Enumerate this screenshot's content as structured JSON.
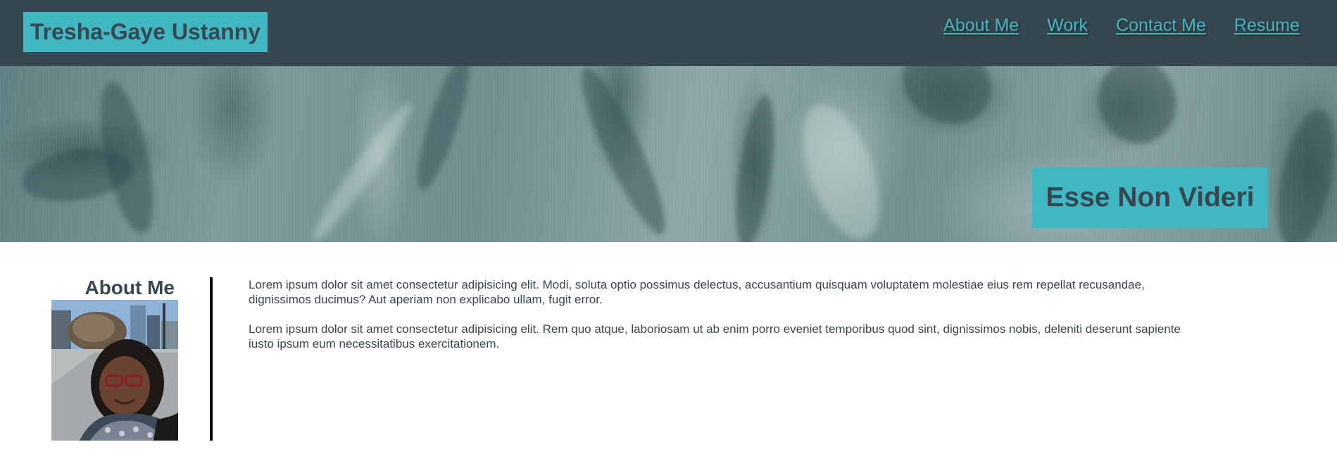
{
  "header": {
    "brand_name": "Tresha-Gaye Ustanny",
    "nav": [
      {
        "label": "About Me"
      },
      {
        "label": "Work"
      },
      {
        "label": "Contact Me"
      },
      {
        "label": "Resume"
      }
    ]
  },
  "hero": {
    "tagline": "Esse Non Videri"
  },
  "about": {
    "heading": "About Me",
    "paragraphs": [
      "Lorem ipsum dolor sit amet consectetur adipisicing elit. Modi, soluta optio possimus delectus, accusantium quisquam voluptatem molestiae eius rem repellat recusandae, dignissimos ducimus? Aut aperiam non explicabo ullam, fugit error.",
      "Lorem ipsum dolor sit amet consectetur adipisicing elit. Rem quo atque, laboriosam ut ab enim porro eveniet temporibus quod sint, dignissimos nobis, deleniti deserunt sapiente iusto ipsum eum necessitatibus exercitationem."
    ]
  },
  "colors": {
    "header_bg": "#37474f",
    "accent": "#3fb8c4",
    "text": "#37474f"
  }
}
